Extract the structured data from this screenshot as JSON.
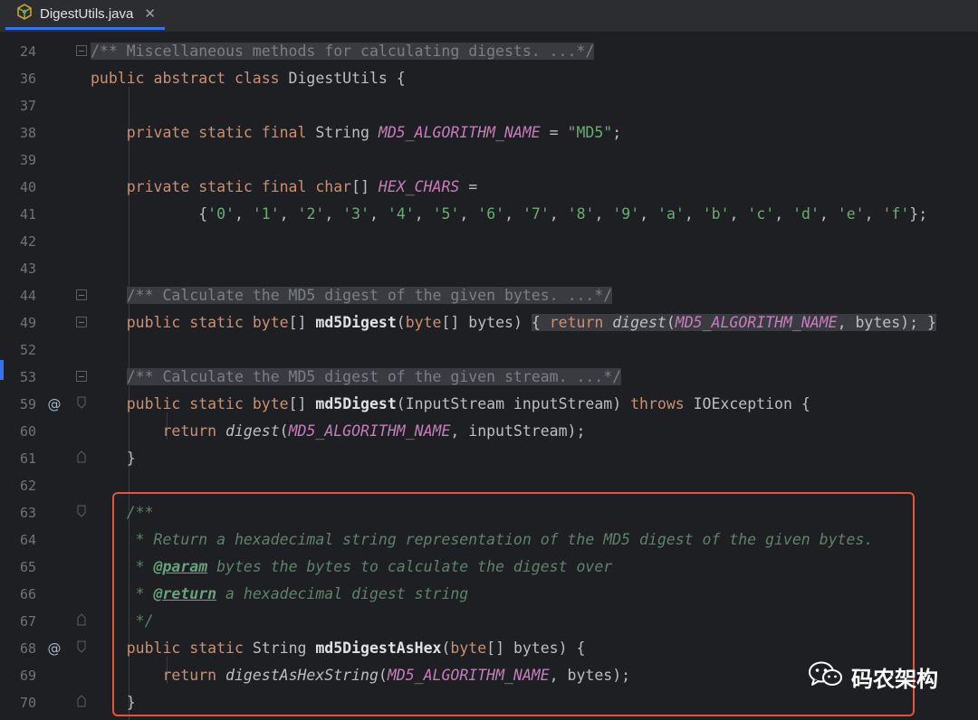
{
  "tab": {
    "file_name": "DigestUtils.java",
    "icon": "java-class-icon",
    "close_label": "✕"
  },
  "lines": [
    {
      "no": "24",
      "gutter": "",
      "fold": "box",
      "segs": [
        {
          "c": "cm foldbg",
          "t": "/** Miscellaneous methods for calculating digests. ...*/"
        }
      ]
    },
    {
      "no": "36",
      "gutter": "",
      "fold": "",
      "segs": [
        {
          "c": "kw",
          "t": "public abstract class "
        },
        {
          "c": "pl",
          "t": "DigestUtils {"
        }
      ]
    },
    {
      "no": "37",
      "gutter": "",
      "fold": "",
      "segs": []
    },
    {
      "no": "38",
      "gutter": "",
      "fold": "",
      "segs": [
        {
          "c": "pl",
          "t": "    "
        },
        {
          "c": "kw",
          "t": "private static final "
        },
        {
          "c": "pl",
          "t": "String "
        },
        {
          "c": "field",
          "t": "MD5_ALGORITHM_NAME"
        },
        {
          "c": "pl",
          "t": " = "
        },
        {
          "c": "str",
          "t": "\"MD5\""
        },
        {
          "c": "pl",
          "t": ";"
        }
      ]
    },
    {
      "no": "39",
      "gutter": "",
      "fold": "",
      "segs": []
    },
    {
      "no": "40",
      "gutter": "",
      "fold": "",
      "segs": [
        {
          "c": "pl",
          "t": "    "
        },
        {
          "c": "kw",
          "t": "private static final char"
        },
        {
          "c": "pl",
          "t": "[] "
        },
        {
          "c": "field",
          "t": "HEX_CHARS"
        },
        {
          "c": "pl",
          "t": " ="
        }
      ]
    },
    {
      "no": "41",
      "gutter": "",
      "fold": "",
      "segs": [
        {
          "c": "pl",
          "t": "            {"
        },
        {
          "c": "str",
          "t": "'0'"
        },
        {
          "c": "pl",
          "t": ", "
        },
        {
          "c": "str",
          "t": "'1'"
        },
        {
          "c": "pl",
          "t": ", "
        },
        {
          "c": "str",
          "t": "'2'"
        },
        {
          "c": "pl",
          "t": ", "
        },
        {
          "c": "str",
          "t": "'3'"
        },
        {
          "c": "pl",
          "t": ", "
        },
        {
          "c": "str",
          "t": "'4'"
        },
        {
          "c": "pl",
          "t": ", "
        },
        {
          "c": "str",
          "t": "'5'"
        },
        {
          "c": "pl",
          "t": ", "
        },
        {
          "c": "str",
          "t": "'6'"
        },
        {
          "c": "pl",
          "t": ", "
        },
        {
          "c": "str",
          "t": "'7'"
        },
        {
          "c": "pl",
          "t": ", "
        },
        {
          "c": "str",
          "t": "'8'"
        },
        {
          "c": "pl",
          "t": ", "
        },
        {
          "c": "str",
          "t": "'9'"
        },
        {
          "c": "pl",
          "t": ", "
        },
        {
          "c": "str",
          "t": "'a'"
        },
        {
          "c": "pl",
          "t": ", "
        },
        {
          "c": "str",
          "t": "'b'"
        },
        {
          "c": "pl",
          "t": ", "
        },
        {
          "c": "str",
          "t": "'c'"
        },
        {
          "c": "pl",
          "t": ", "
        },
        {
          "c": "str",
          "t": "'d'"
        },
        {
          "c": "pl",
          "t": ", "
        },
        {
          "c": "str",
          "t": "'e'"
        },
        {
          "c": "pl",
          "t": ", "
        },
        {
          "c": "str",
          "t": "'f'"
        },
        {
          "c": "pl",
          "t": "};"
        }
      ]
    },
    {
      "no": "42",
      "gutter": "",
      "fold": "",
      "segs": []
    },
    {
      "no": "43",
      "gutter": "",
      "fold": "",
      "segs": []
    },
    {
      "no": "44",
      "gutter": "",
      "fold": "box",
      "segs": [
        {
          "c": "pl",
          "t": "    "
        },
        {
          "c": "cm foldbg",
          "t": "/** Calculate the MD5 digest of the given bytes. ...*/"
        }
      ]
    },
    {
      "no": "49",
      "gutter": "",
      "fold": "box",
      "segs": [
        {
          "c": "pl",
          "t": "    "
        },
        {
          "c": "kw",
          "t": "public static "
        },
        {
          "c": "kw",
          "t": "byte"
        },
        {
          "c": "pl",
          "t": "[] "
        },
        {
          "c": "fnb",
          "t": "md5Digest"
        },
        {
          "c": "pl",
          "t": "("
        },
        {
          "c": "kw",
          "t": "byte"
        },
        {
          "c": "pl",
          "t": "[] bytes) "
        },
        {
          "c": "pl foldbg",
          "t": "{ "
        },
        {
          "c": "kw foldbg",
          "t": "return "
        },
        {
          "c": "ital foldbg",
          "t": "digest"
        },
        {
          "c": "pl foldbg",
          "t": "("
        },
        {
          "c": "field foldbg",
          "t": "MD5_ALGORITHM_NAME"
        },
        {
          "c": "pl foldbg",
          "t": ", bytes); }"
        }
      ]
    },
    {
      "no": "52",
      "gutter": "",
      "fold": "",
      "segs": []
    },
    {
      "no": "53",
      "gutter": "",
      "fold": "box",
      "segs": [
        {
          "c": "pl",
          "t": "    "
        },
        {
          "c": "cm foldbg",
          "t": "/** Calculate the MD5 digest of the given stream. ...*/"
        }
      ]
    },
    {
      "no": "59",
      "gutter": "@",
      "fold": "open",
      "segs": [
        {
          "c": "pl",
          "t": "    "
        },
        {
          "c": "kw",
          "t": "public static "
        },
        {
          "c": "kw",
          "t": "byte"
        },
        {
          "c": "pl",
          "t": "[] "
        },
        {
          "c": "fnb",
          "t": "md5Digest"
        },
        {
          "c": "pl",
          "t": "(InputStream inputStream) "
        },
        {
          "c": "kw",
          "t": "throws "
        },
        {
          "c": "pl",
          "t": "IOException {"
        }
      ]
    },
    {
      "no": "60",
      "gutter": "",
      "fold": "",
      "segs": [
        {
          "c": "pl",
          "t": "        "
        },
        {
          "c": "kw",
          "t": "return "
        },
        {
          "c": "ital",
          "t": "digest"
        },
        {
          "c": "pl",
          "t": "("
        },
        {
          "c": "field",
          "t": "MD5_ALGORITHM_NAME"
        },
        {
          "c": "pl",
          "t": ", inputStream);"
        }
      ]
    },
    {
      "no": "61",
      "gutter": "",
      "fold": "end",
      "segs": [
        {
          "c": "pl",
          "t": "    }"
        }
      ]
    },
    {
      "no": "62",
      "gutter": "",
      "fold": "",
      "segs": []
    },
    {
      "no": "63",
      "gutter": "",
      "fold": "open",
      "segs": [
        {
          "c": "pl",
          "t": "    "
        },
        {
          "c": "doc",
          "t": "/**"
        }
      ]
    },
    {
      "no": "64",
      "gutter": "",
      "fold": "",
      "segs": [
        {
          "c": "pl",
          "t": "     "
        },
        {
          "c": "doc",
          "t": "* Return a hexadecimal string representation of the MD5 digest of the given bytes."
        }
      ]
    },
    {
      "no": "65",
      "gutter": "",
      "fold": "",
      "segs": [
        {
          "c": "pl",
          "t": "     "
        },
        {
          "c": "doc",
          "t": "* "
        },
        {
          "c": "doctag",
          "t": "@param"
        },
        {
          "c": "doc",
          "t": " "
        },
        {
          "c": "doc",
          "t": "bytes"
        },
        {
          "c": "doc",
          "t": " the bytes to calculate the digest over"
        }
      ]
    },
    {
      "no": "66",
      "gutter": "",
      "fold": "",
      "segs": [
        {
          "c": "pl",
          "t": "     "
        },
        {
          "c": "doc",
          "t": "* "
        },
        {
          "c": "doctag",
          "t": "@return"
        },
        {
          "c": "doc",
          "t": " a hexadecimal digest string"
        }
      ]
    },
    {
      "no": "67",
      "gutter": "",
      "fold": "end",
      "segs": [
        {
          "c": "pl",
          "t": "     "
        },
        {
          "c": "doc",
          "t": "*/"
        }
      ]
    },
    {
      "no": "68",
      "gutter": "@",
      "fold": "open",
      "segs": [
        {
          "c": "pl",
          "t": "    "
        },
        {
          "c": "kw",
          "t": "public static "
        },
        {
          "c": "pl",
          "t": "String "
        },
        {
          "c": "fnb",
          "t": "md5DigestAsHex"
        },
        {
          "c": "pl",
          "t": "("
        },
        {
          "c": "kw",
          "t": "byte"
        },
        {
          "c": "pl",
          "t": "[] bytes) {"
        }
      ]
    },
    {
      "no": "69",
      "gutter": "",
      "fold": "",
      "segs": [
        {
          "c": "pl",
          "t": "        "
        },
        {
          "c": "kw",
          "t": "return "
        },
        {
          "c": "ital",
          "t": "digestAsHexString"
        },
        {
          "c": "pl",
          "t": "("
        },
        {
          "c": "field",
          "t": "MD5_ALGORITHM_NAME"
        },
        {
          "c": "pl",
          "t": ", bytes);"
        }
      ]
    },
    {
      "no": "70",
      "gutter": "",
      "fold": "end",
      "segs": [
        {
          "c": "pl",
          "t": "    }"
        }
      ]
    }
  ],
  "watermark": {
    "text": "码农架构",
    "icon": "wechat-icon"
  },
  "colors": {
    "highlight_border": "#e5533a",
    "keyword": "#cf8e6d",
    "field": "#c77dbb",
    "string": "#6aab73",
    "doc_comment": "#5f826b"
  }
}
